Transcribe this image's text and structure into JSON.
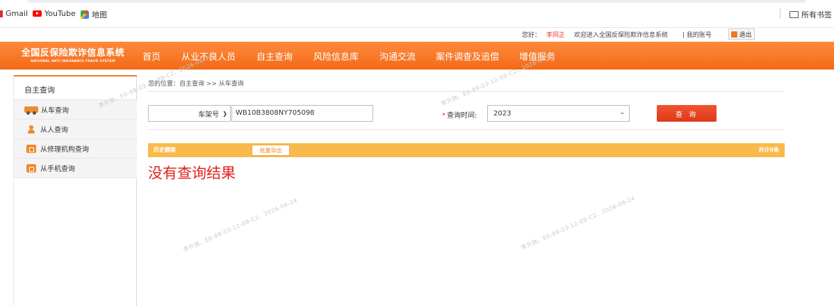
{
  "bookmarks": [
    {
      "label": "Gmail",
      "icon": "gmail-icon"
    },
    {
      "label": "YouTube",
      "icon": "youtube-icon"
    },
    {
      "label": "地图",
      "icon": "maps-icon"
    }
  ],
  "bookmarks_folder": {
    "label": "所有书签",
    "icon": "folder-icon"
  },
  "topbar": {
    "greeting": "您好：",
    "username": "李同正",
    "welcome": "欢迎进入全国反保险欺诈信息系统",
    "account": "| 我的账号",
    "logout": "退出"
  },
  "logo": {
    "cn": "全国反保险欺诈信息系统",
    "en": "NATIONAL ANTI INSURANCE FRAUD SYSTEM"
  },
  "nav": [
    "首页",
    "从业不良人员",
    "自主查询",
    "风险信息库",
    "沟通交流",
    "案件调查及追偿",
    "增值服务"
  ],
  "sidebar": {
    "title": "自主查询",
    "items": [
      {
        "label": "从车查询",
        "icon": "car-icon"
      },
      {
        "label": "从人查询",
        "icon": "person-icon"
      },
      {
        "label": "从修理机构查询",
        "icon": "repair-shop-icon"
      },
      {
        "label": "从手机查询",
        "icon": "phone-icon"
      }
    ]
  },
  "breadcrumb": "您的位置：自主查询 >> 从车查询",
  "form": {
    "type_select": "车架号",
    "vin_value": "WB10B3808NY705098",
    "time_label": "查询时间:",
    "time_star": "*",
    "year_select": "2023",
    "query_button": "查 询"
  },
  "history": {
    "title": "历史翻案",
    "export_button": "批量导出",
    "count": "共计0条"
  },
  "result_message": "没有查询结果",
  "watermark": "李开放、E0-88-03-12-88-C2、2026-06-24",
  "colors": {
    "nav_orange": "#f26a18",
    "accent_red": "#e0231f",
    "history_bar": "#f9b94b"
  }
}
